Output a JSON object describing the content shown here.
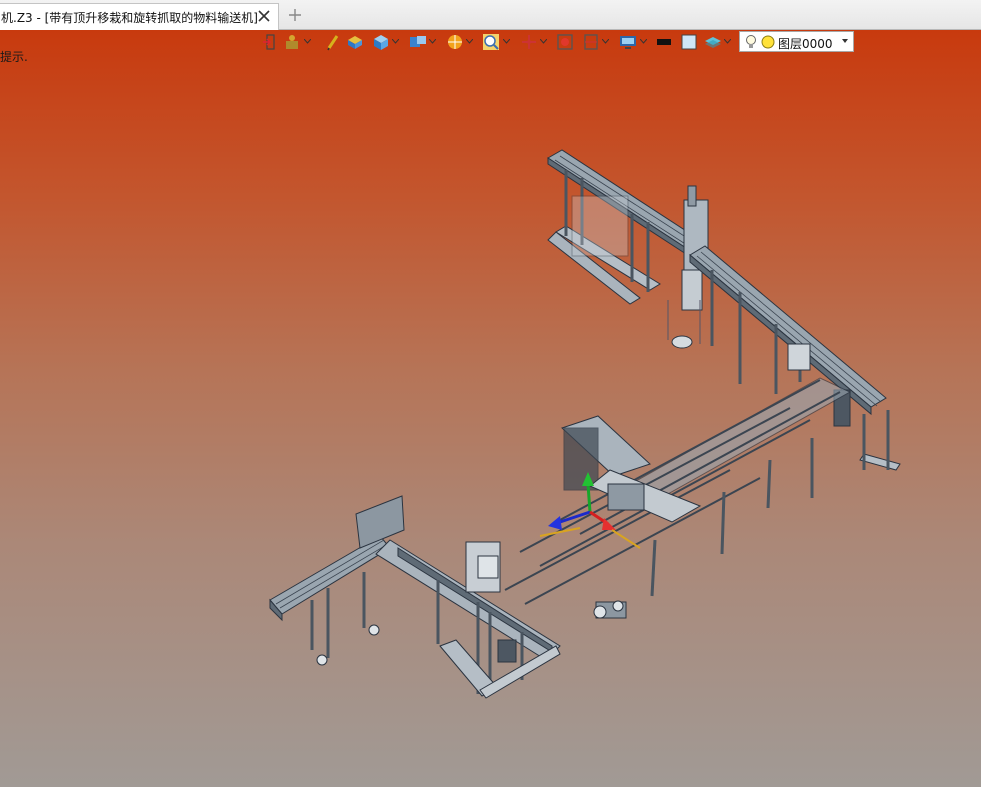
{
  "tab": {
    "title": "机.Z3 - [带有顶升移栽和旋转抓取的物料输送机]",
    "close_icon": "close-icon",
    "add_icon": "plus-icon"
  },
  "viewport": {
    "prompt": "提示.",
    "background_top": "#c83a0e",
    "background_bottom": "#a19a95"
  },
  "toolbar": {
    "layer_dropdown_value": "图层0000"
  }
}
